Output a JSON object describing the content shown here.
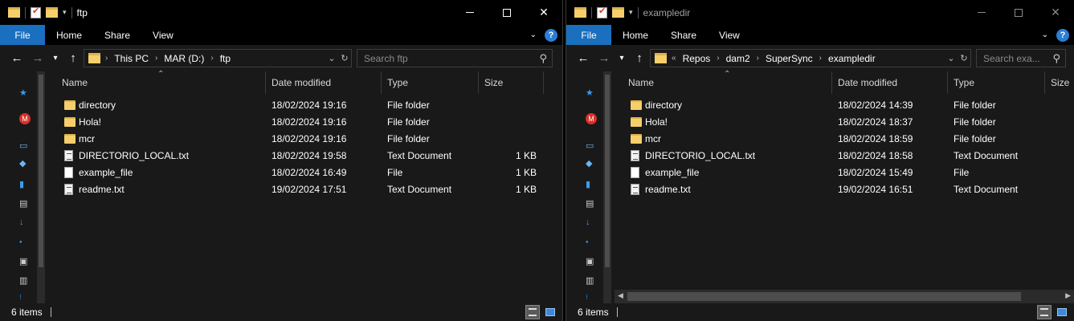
{
  "left": {
    "title": "ftp",
    "ribbon": {
      "file": "File",
      "home": "Home",
      "share": "Share",
      "view": "View",
      "help": "?"
    },
    "breadcrumb": [
      "This PC",
      "MAR (D:)",
      "ftp"
    ],
    "search_placeholder": "Search ftp",
    "columns": {
      "name": "Name",
      "date": "Date modified",
      "type": "Type",
      "size": "Size"
    },
    "rows": [
      {
        "name": "directory",
        "date": "18/02/2024 19:16",
        "type": "File folder",
        "size": "",
        "icon": "folder-icon"
      },
      {
        "name": "Hola!",
        "date": "18/02/2024 19:16",
        "type": "File folder",
        "size": "",
        "icon": "folder-icon"
      },
      {
        "name": "mcr",
        "date": "18/02/2024 19:16",
        "type": "File folder",
        "size": "",
        "icon": "folder-icon"
      },
      {
        "name": "DIRECTORIO_LOCAL.txt",
        "date": "18/02/2024 19:58",
        "type": "Text Document",
        "size": "1 KB",
        "icon": "text-file-icon"
      },
      {
        "name": "example_file",
        "date": "18/02/2024 16:49",
        "type": "File",
        "size": "1 KB",
        "icon": "file-icon"
      },
      {
        "name": "readme.txt",
        "date": "19/02/2024 17:51",
        "type": "Text Document",
        "size": "1 KB",
        "icon": "text-file-icon"
      }
    ],
    "status": "6 items"
  },
  "right": {
    "title": "exampledir",
    "ribbon": {
      "file": "File",
      "home": "Home",
      "share": "Share",
      "view": "View",
      "help": "?"
    },
    "breadcrumb_overflow": "«",
    "breadcrumb": [
      "Repos",
      "dam2",
      "SuperSync",
      "exampledir"
    ],
    "search_placeholder": "Search exa...",
    "columns": {
      "name": "Name",
      "date": "Date modified",
      "type": "Type",
      "size": "Size"
    },
    "rows": [
      {
        "name": "directory",
        "date": "18/02/2024 14:39",
        "type": "File folder",
        "icon": "folder-icon"
      },
      {
        "name": "Hola!",
        "date": "18/02/2024 18:37",
        "type": "File folder",
        "icon": "folder-icon"
      },
      {
        "name": "mcr",
        "date": "18/02/2024 18:59",
        "type": "File folder",
        "icon": "folder-icon"
      },
      {
        "name": "DIRECTORIO_LOCAL.txt",
        "date": "18/02/2024 18:58",
        "type": "Text Document",
        "icon": "text-file-icon"
      },
      {
        "name": "example_file",
        "date": "18/02/2024 15:49",
        "type": "File",
        "icon": "file-icon"
      },
      {
        "name": "readme.txt",
        "date": "19/02/2024 16:51",
        "type": "Text Document",
        "icon": "text-file-icon"
      }
    ],
    "status": "6 items"
  },
  "colors": {
    "accent": "#1a6fbe",
    "folder": "#f6cf6b",
    "background": "#191919"
  }
}
